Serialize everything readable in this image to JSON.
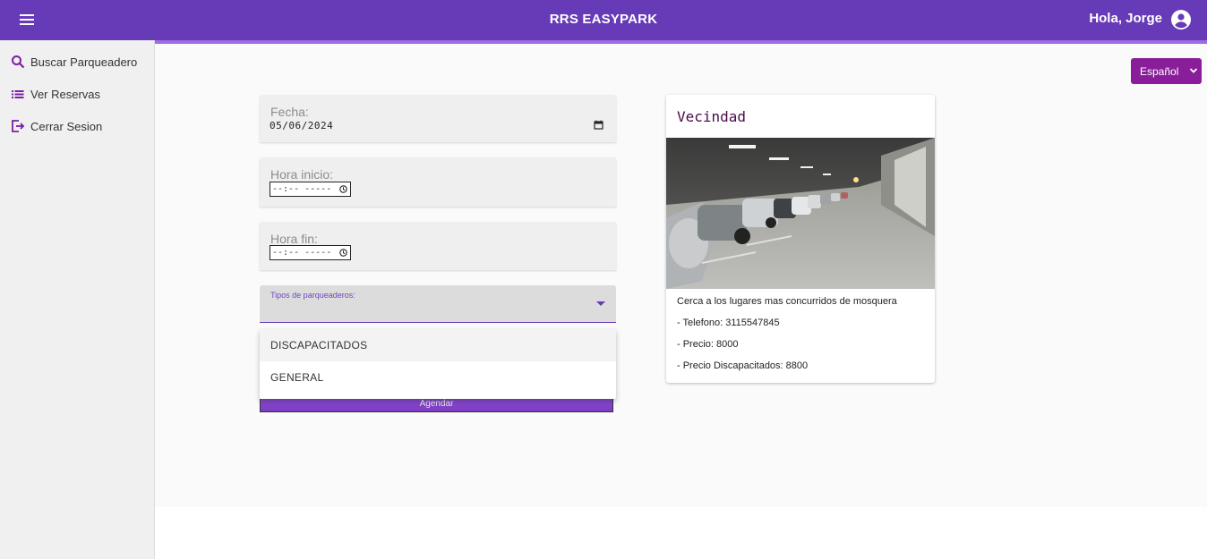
{
  "header": {
    "title": "RRS EASYPARK",
    "greeting": "Hola, Jorge"
  },
  "sidebar": {
    "items": [
      {
        "label": "Buscar Parqueadero",
        "icon": "search-icon"
      },
      {
        "label": "Ver Reservas",
        "icon": "list-icon"
      },
      {
        "label": "Cerrar Sesion",
        "icon": "logout-icon"
      }
    ]
  },
  "language": {
    "selected": "Español"
  },
  "form": {
    "fecha_label": "Fecha:",
    "fecha_value": "05/06/2024",
    "hora_inicio_label": "Hora inicio:",
    "hora_inicio_value": "--:-- -----",
    "hora_fin_label": "Hora fin:",
    "hora_fin_value": "--:-- -----",
    "tipo_label": "Tipos de parqueaderos:",
    "options": [
      "DISCAPACITADOS",
      "GENERAL"
    ],
    "submit_label": "Agendar"
  },
  "card": {
    "title": "Vecindad",
    "description": "Cerca a los lugares mas concurridos de mosquera",
    "telefono": "- Telefono: 3115547845",
    "precio": "- Precio: 8000",
    "precio_discapacitados": "- Precio Discapacitados: 8800"
  },
  "colors": {
    "primary": "#673ab7",
    "accent": "#8a1e9a"
  }
}
